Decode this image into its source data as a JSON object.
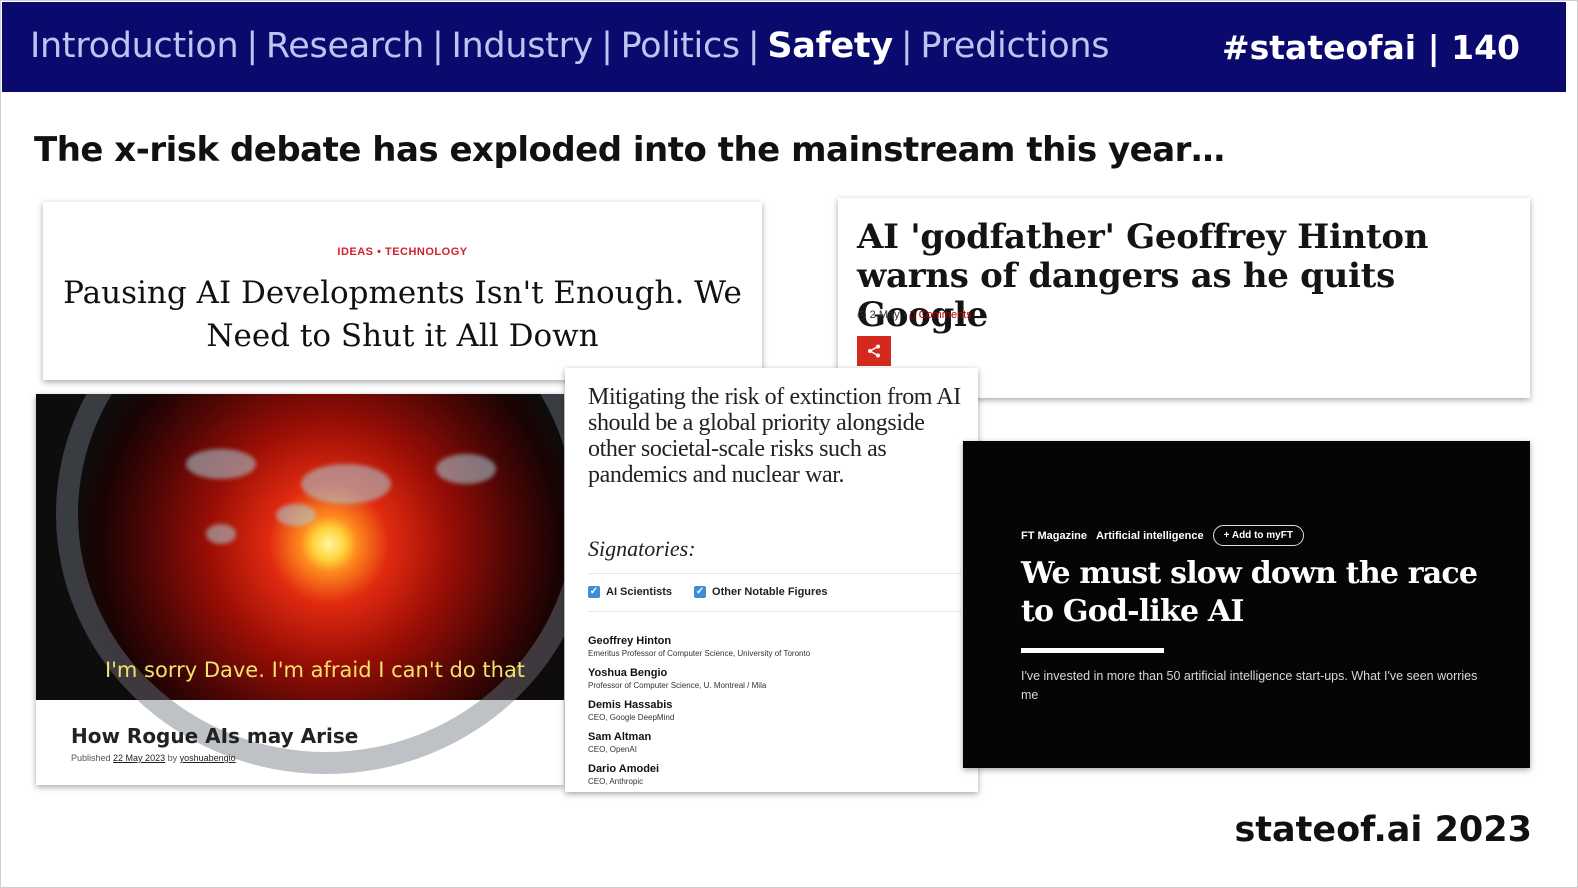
{
  "nav": {
    "items": [
      "Introduction",
      "Research",
      "Industry",
      "Politics",
      "Safety",
      "Predictions"
    ],
    "active": "Safety",
    "tag": "#stateofai | 140"
  },
  "headline": "The x-risk debate has exploded into the mainstream this year…",
  "footer": "stateof.ai 2023",
  "time_card": {
    "kicker": "IDEAS • TECHNOLOGY",
    "title": "Pausing AI Developments Isn't Enough. We Need to Shut it All Down"
  },
  "bbc_card": {
    "title": "AI 'godfather' Geoffrey Hinton warns of dangers as he quits Google",
    "date": "2 May",
    "comments": "Comments",
    "icons": [
      "clock-icon",
      "comment-icon",
      "share-icon"
    ],
    "accent": "#d42a1e"
  },
  "hal_card": {
    "quote": "I'm sorry Dave. I'm afraid I can't do that",
    "title": "How Rogue AIs may Arise",
    "published_prefix": "Published",
    "published_date": "22 May 2023",
    "by": "by",
    "author": "yoshuabengio"
  },
  "cais_card": {
    "statement": "Mitigating the risk of extinction from AI should be a global priority alongside other societal-scale risks such as pandemics and nuclear war.",
    "signatories_label": "Signatories:",
    "filters": [
      "AI Scientists",
      "Other Notable Figures"
    ],
    "people": [
      {
        "name": "Geoffrey Hinton",
        "role": "Emeritus Professor of Computer Science, University of Toronto"
      },
      {
        "name": "Yoshua Bengio",
        "role": "Professor of Computer Science, U. Montreal / Mila"
      },
      {
        "name": "Demis Hassabis",
        "role": "CEO, Google DeepMind"
      },
      {
        "name": "Sam Altman",
        "role": "CEO, OpenAI"
      },
      {
        "name": "Dario Amodei",
        "role": "CEO, Anthropic"
      }
    ]
  },
  "ft_card": {
    "section": "FT Magazine",
    "topic": "Artificial intelligence",
    "add_label": "+ Add to myFT",
    "title": "We must slow down the race to God-like AI",
    "description": "I've invested in more than 50 artificial intelligence start-ups. What I've seen worries me"
  }
}
